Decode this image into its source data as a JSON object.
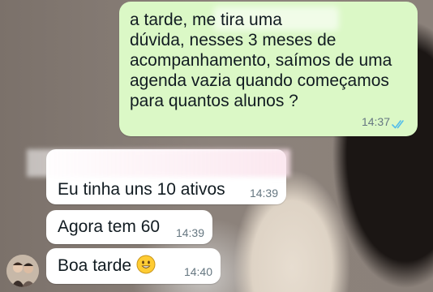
{
  "chat": {
    "outgoing_message": {
      "text": "a tarde, me tira uma\ndúvida, nesses 3 meses de\nacompanhamento, saímos de uma\nagenda vazia quando começamos\npara quantos alunos ?",
      "time": "14:37"
    },
    "incoming_messages": [
      {
        "text": "Eu tinha uns 10 ativos",
        "time": "14:39"
      },
      {
        "text": "Agora tem 60",
        "time": "14:39"
      },
      {
        "text": "Boa tarde",
        "time": "14:40",
        "emoji": "smiling-face-emoji"
      }
    ]
  },
  "colors": {
    "outgoing_bubble": "#dbf8c6",
    "incoming_bubble": "#ffffff",
    "read_ticks": "#53bdeb"
  }
}
